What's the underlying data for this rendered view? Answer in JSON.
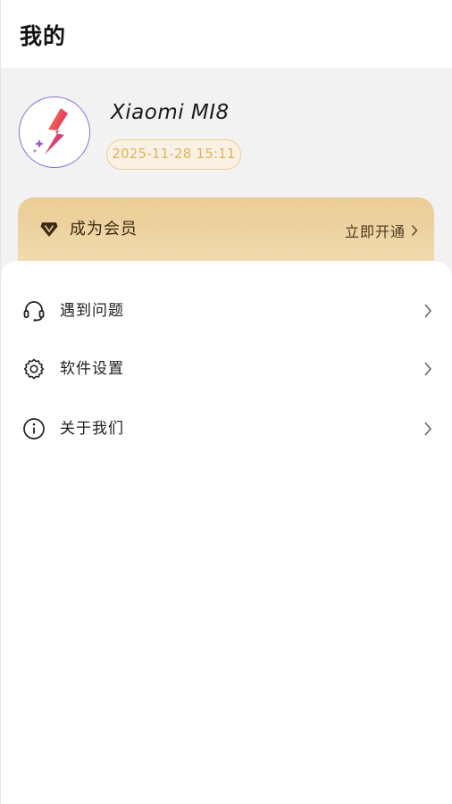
{
  "header": {
    "title": "我的"
  },
  "profile": {
    "avatar_icon": "lightning-logo-icon",
    "device_name": "Xiaomi MI8",
    "timestamp": "2025-11-28 15:11"
  },
  "vip": {
    "icon": "diamond-icon",
    "label": "成为会员",
    "action_label": "立即开通"
  },
  "menu": {
    "items": [
      {
        "label": "遇到问题",
        "icon": "headset-icon"
      },
      {
        "label": "软件设置",
        "icon": "gear-icon"
      },
      {
        "label": "关于我们",
        "icon": "info-icon"
      }
    ]
  },
  "colors": {
    "vip_gold": "#eacc95",
    "badge_text": "#e2b15d",
    "avatar_border": "#8b6fd8",
    "band_grey": "#f2f2f2"
  }
}
